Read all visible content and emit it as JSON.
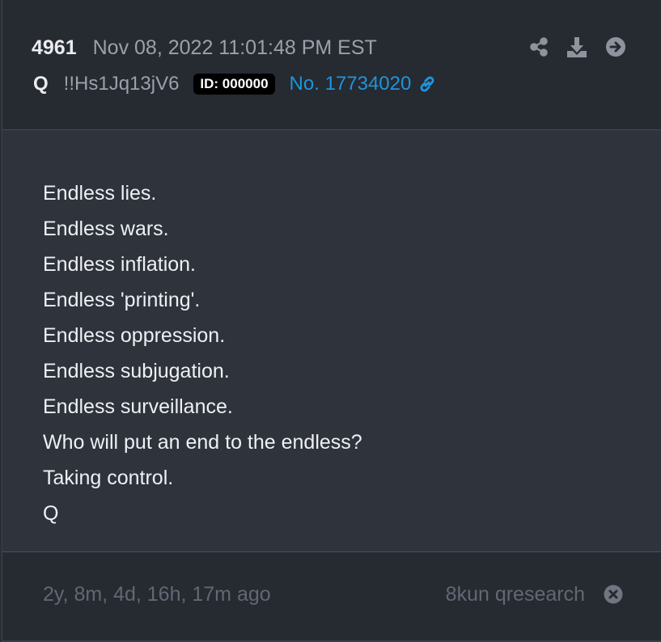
{
  "post": {
    "number": "4961",
    "date": "Nov 08, 2022 11:01:48 PM EST",
    "author": "Q",
    "tripcode": "!!Hs1Jq13jV6",
    "id_badge": "ID: 000000",
    "post_link": "No. 17734020"
  },
  "body": {
    "lines": [
      "Endless lies.",
      "Endless wars.",
      "Endless inflation.",
      "Endless 'printing'.",
      "Endless oppression.",
      "Endless subjugation.",
      "Endless surveillance.",
      "Who will put an end to the endless?",
      "Taking control.",
      "Q"
    ]
  },
  "footer": {
    "elapsed": "2y, 8m, 4d, 16h, 17m ago",
    "source": "8kun qresearch"
  },
  "icons": {
    "share": "share-icon",
    "download": "download-icon",
    "go": "arrow-circle-right-icon",
    "link": "link-icon",
    "close": "times-circle-icon"
  },
  "colors": {
    "link": "#1d95dc",
    "icon": "#8e949e",
    "header_bg": "#262a31",
    "body_bg": "#2e333c"
  }
}
